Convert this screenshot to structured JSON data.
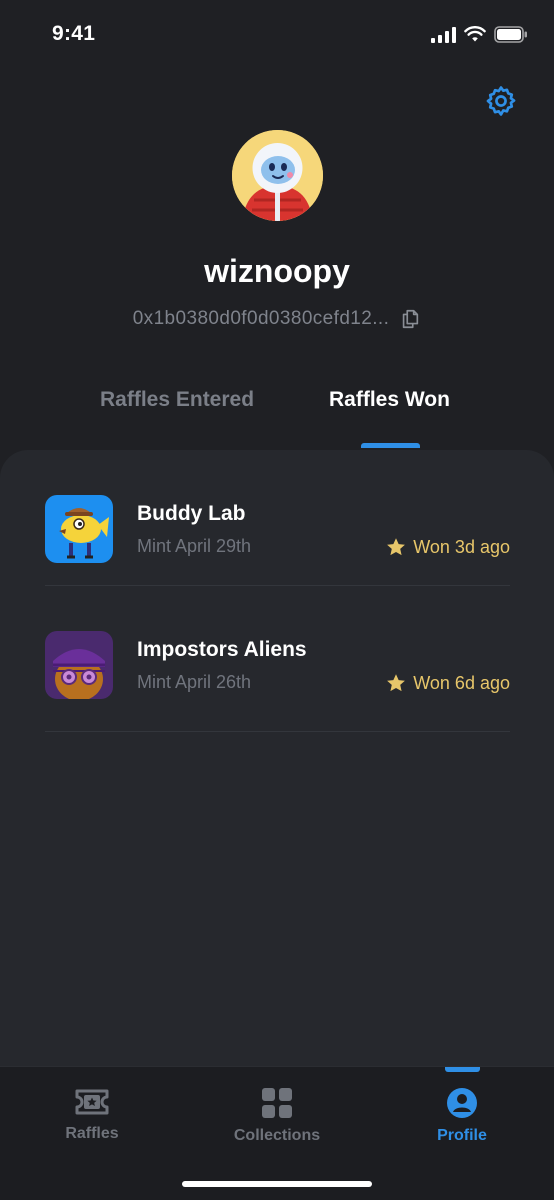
{
  "status_bar": {
    "time": "9:41"
  },
  "profile": {
    "username": "wiznoopy",
    "wallet_address": "0x1b0380d0f0d0380cefd12..."
  },
  "tabs": [
    {
      "label": "Raffles Entered",
      "active": false
    },
    {
      "label": "Raffles Won",
      "active": true
    }
  ],
  "won_raffles": [
    {
      "title": "Buddy Lab",
      "mint": "Mint April 29th",
      "status": "Won 3d ago"
    },
    {
      "title": "Impostors Aliens",
      "mint": "Mint April 26th",
      "status": "Won 6d ago"
    }
  ],
  "bottom_nav": [
    {
      "label": "Raffles",
      "icon": "ticket-icon",
      "active": false
    },
    {
      "label": "Collections",
      "icon": "grid-icon",
      "active": false
    },
    {
      "label": "Profile",
      "icon": "user-icon",
      "active": true
    }
  ],
  "colors": {
    "accent": "#2f8fe6",
    "background": "#1f2024",
    "panel": "#26282d",
    "won": "#e7c66a"
  }
}
